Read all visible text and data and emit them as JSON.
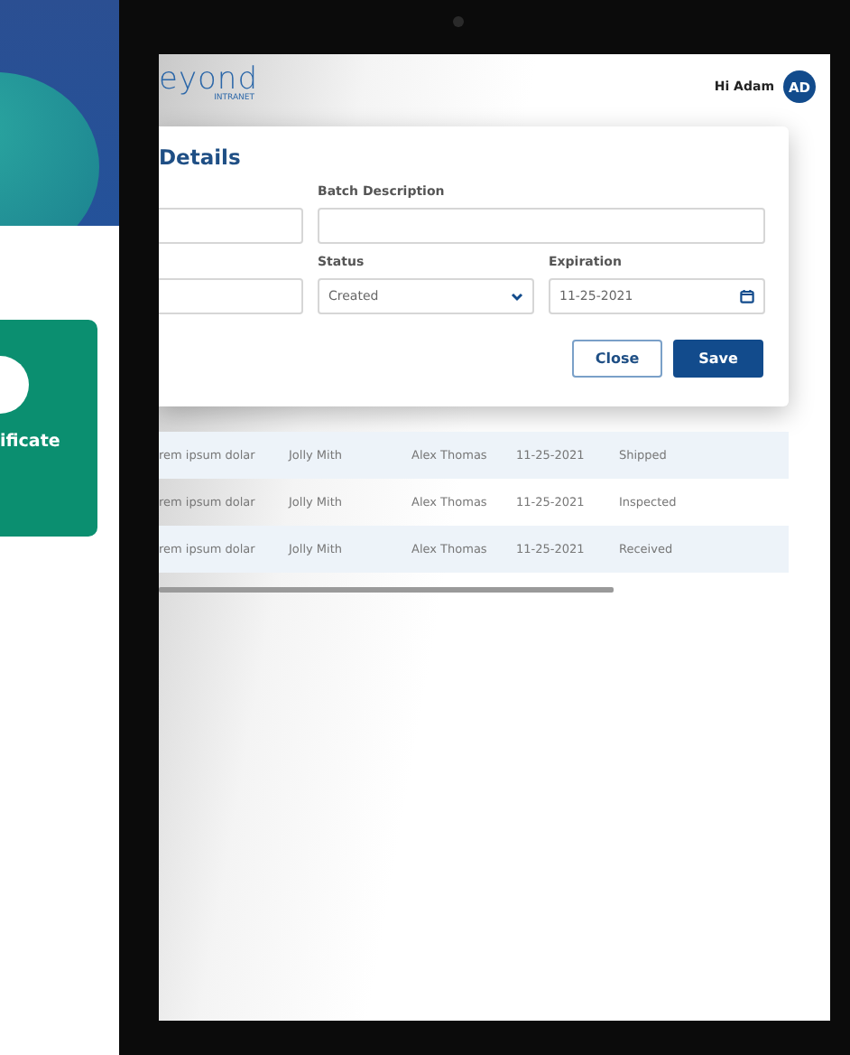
{
  "phone": {
    "card": {
      "label": "ificate"
    }
  },
  "tablet": {
    "header": {
      "logo": "eyond",
      "logo_sub": "INTRANET",
      "greeting": "Hi Adam",
      "avatar": "AD"
    },
    "modal": {
      "title": "Details",
      "fields": [
        {
          "kind": "blank"
        },
        {
          "kind": "text",
          "label": "Batch Description"
        },
        {
          "kind": "blank"
        },
        {
          "kind": "select",
          "label": "Status",
          "value": "Created"
        },
        {
          "kind": "date",
          "label": "Expiration",
          "value": "11-25-2021"
        }
      ],
      "buttons": [
        {
          "kind": "secondary",
          "label": "Close"
        },
        {
          "kind": "primary",
          "label": "Save"
        }
      ]
    },
    "table": {
      "rows": [
        [
          "rem ipsum dolar",
          "Jolly Mith",
          "Alex Thomas",
          "11-25-2021",
          "Shipped"
        ],
        [
          "rem ipsum dolar",
          "Jolly Mith",
          "Alex Thomas",
          "11-25-2021",
          "Inspected"
        ],
        [
          "rem ipsum dolar",
          "Jolly Mith",
          "Alex Thomas",
          "11-25-2021",
          "Received"
        ]
      ]
    }
  }
}
